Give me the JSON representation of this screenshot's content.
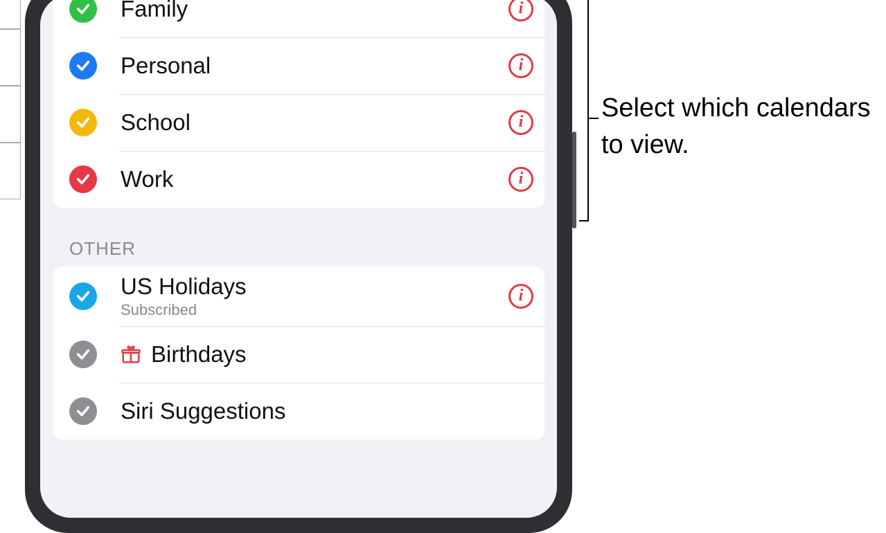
{
  "calendars_main": [
    {
      "label": "Family",
      "color": "#30c048",
      "has_info": true
    },
    {
      "label": "Personal",
      "color": "#1e7af0",
      "has_info": true
    },
    {
      "label": "School",
      "color": "#f2b90c",
      "has_info": true
    },
    {
      "label": "Work",
      "color": "#e63946",
      "has_info": true
    }
  ],
  "section_other_header": "OTHER",
  "calendars_other": [
    {
      "label": "US Holidays",
      "sublabel": "Subscribed",
      "color": "#1aa7e8",
      "has_info": true,
      "icon": null
    },
    {
      "label": "Birthdays",
      "sublabel": null,
      "color": "#8e8e93",
      "has_info": false,
      "icon": "gift"
    },
    {
      "label": "Siri Suggestions",
      "sublabel": null,
      "color": "#8e8e93",
      "has_info": false,
      "icon": null
    }
  ],
  "annotation": "Select which calendars to view."
}
